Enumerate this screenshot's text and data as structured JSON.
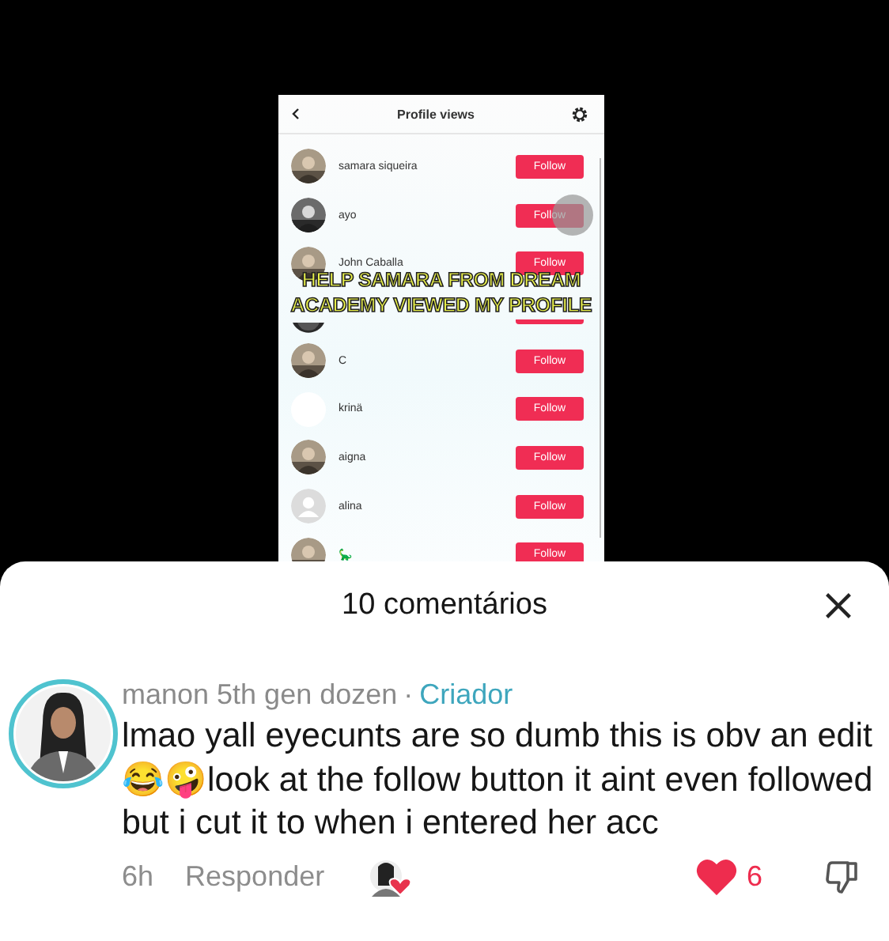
{
  "video": {
    "screen_title": "Profile views",
    "caption": [
      "HELP SAMARA FROM DREAM",
      "ACADEMY VIEWED MY PROFILE"
    ],
    "viewers": [
      {
        "name": "samara siqueira",
        "button": "Follow",
        "touched": false
      },
      {
        "name": "ayo",
        "button": "Follow",
        "touched": true
      },
      {
        "name": "John Caballa",
        "button": "Follow",
        "touched": false
      },
      {
        "kind": "partial",
        "touched": false
      },
      {
        "name": "C",
        "button": "Follow",
        "touched": false
      },
      {
        "name": "krinä",
        "kind": "blank",
        "button": "Follow",
        "touched": false
      },
      {
        "name": "aigna",
        "button": "Follow",
        "touched": false
      },
      {
        "name": "alina",
        "kind": "default",
        "button": "Follow",
        "touched": false
      },
      {
        "name": "🦕",
        "button": "Follow",
        "touched": false
      }
    ]
  },
  "comments_sheet": {
    "title": "10 comentários",
    "comment": {
      "author": "manon 5th gen dozen",
      "separator": "·",
      "badge": "Criador",
      "text": "lmao yall eyecunts are so dumb this is obv an edit😂🤪look at the follow button it aint even followed but i cut it to when i entered her acc",
      "time": "6h",
      "reply": "Responder",
      "liked_by_creator": true,
      "liked": true,
      "likes": "6"
    }
  }
}
